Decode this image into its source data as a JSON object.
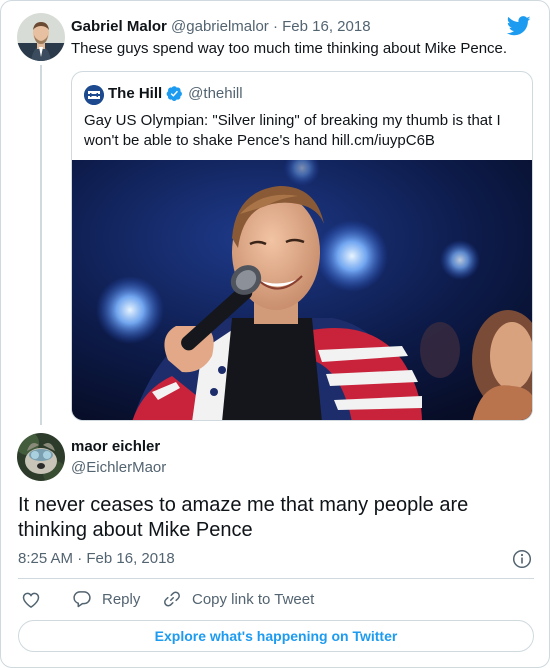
{
  "colors": {
    "accent": "#1d9bf0",
    "text_primary": "#0f1419",
    "text_secondary": "#536471",
    "border": "#cfd9de"
  },
  "parent_tweet": {
    "author_name": "Gabriel Malor",
    "handle": "@gabrielmalor",
    "separator": "·",
    "date": "Feb 16, 2018",
    "text": "These guys spend way too much time thinking about Mike Pence.",
    "avatar_icon": "avatar-photo",
    "brand_icon": "twitter-bird-icon"
  },
  "quoted_tweet": {
    "author_name": "The Hill",
    "verified_icon": "verified-badge-icon",
    "handle": "@thehill",
    "text": "Gay US Olympian: \"Silver lining\" of breaking my thumb is that I won't be able to shake Pence's hand hill.cm/iuypC6B",
    "logo_text": "THE HILL",
    "image_description_icon": "photo"
  },
  "reply_tweet": {
    "author_name": "maor eichler",
    "handle": "@EichlerMaor",
    "text": "It never ceases to amaze me that many people are thinking about Mike Pence",
    "timestamp": "8:25 AM · Feb 16, 2018",
    "info_icon": "info-icon"
  },
  "actions": {
    "like_icon": "heart-icon",
    "reply_label": "Reply",
    "reply_icon": "reply-icon",
    "copy_label": "Copy link to Tweet",
    "copy_icon": "link-icon"
  },
  "explore_button": {
    "label": "Explore what's happening on Twitter"
  }
}
